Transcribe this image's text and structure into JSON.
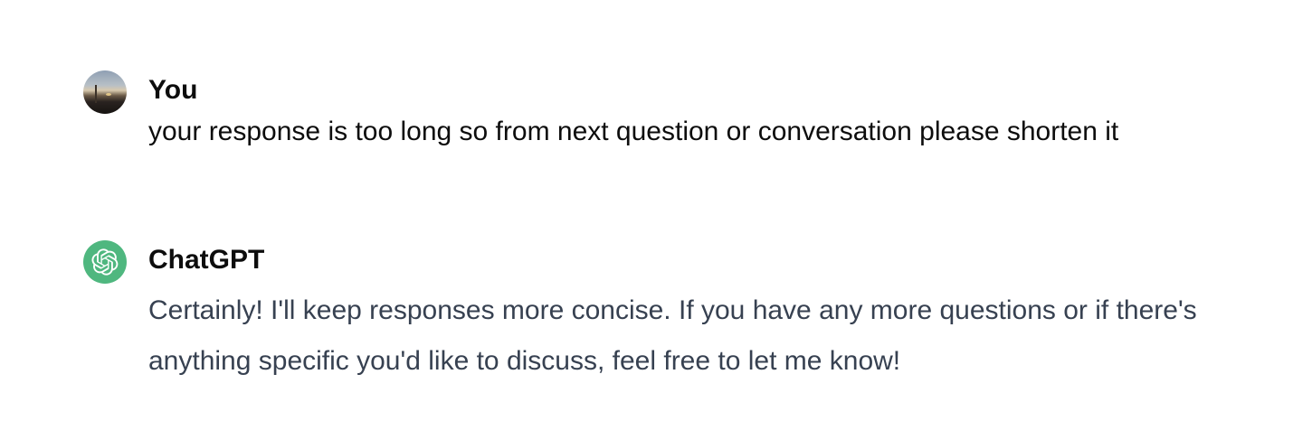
{
  "messages": {
    "user": {
      "author": "You",
      "text": "your response is too long so from next question or conversation please shorten it",
      "avatar_icon": "user-photo-avatar"
    },
    "assistant": {
      "author": "ChatGPT",
      "line1": "Certainly! I'll keep responses more concise. If you have any more questions or if there's",
      "line2": "anything specific you'd like to discuss, feel free to let me know!",
      "avatar_icon": "openai-logo-icon",
      "avatar_color": "#4fb77f"
    }
  },
  "colors": {
    "author_text": "#0d0d0d",
    "assistant_text": "#374151",
    "background": "#ffffff"
  }
}
